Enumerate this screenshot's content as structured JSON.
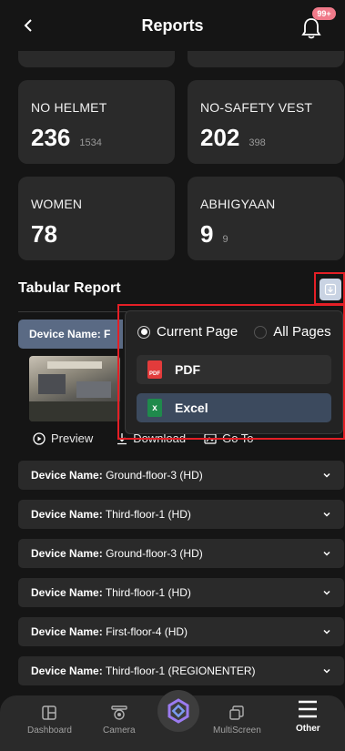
{
  "header": {
    "title": "Reports",
    "notification_badge": "99+"
  },
  "stats": [
    {
      "label": "NO HELMET",
      "value": "236",
      "sub": "1534"
    },
    {
      "label": "NO-SAFETY VEST",
      "value": "202",
      "sub": "398"
    },
    {
      "label": "WOMEN",
      "value": "78",
      "sub": ""
    },
    {
      "label": "ABHIGYAAN",
      "value": "9",
      "sub": "9"
    }
  ],
  "tabular": {
    "title": "Tabular Report",
    "expanded_row_prefix": "Device Name: F",
    "actions": {
      "preview": "Preview",
      "download": "Download",
      "goto": "Go To"
    }
  },
  "export_menu": {
    "scope_options": [
      "Current Page",
      "All Pages"
    ],
    "selected_scope": "Current Page",
    "formats": [
      "PDF",
      "Excel"
    ]
  },
  "device_rows": [
    {
      "prefix": "Device Name:",
      "name": "Ground-floor-3 (HD)"
    },
    {
      "prefix": "Device Name:",
      "name": "Third-floor-1 (HD)"
    },
    {
      "prefix": "Device Name:",
      "name": "Ground-floor-3 (HD)"
    },
    {
      "prefix": "Device Name:",
      "name": "Third-floor-1 (HD)"
    },
    {
      "prefix": "Device Name:",
      "name": "First-floor-4 (HD)"
    },
    {
      "prefix": "Device Name:",
      "name": "Third-floor-1 (REGIONENTER)"
    }
  ],
  "nav": {
    "dashboard": "Dashboard",
    "camera": "Camera",
    "multiscreen": "MultiScreen",
    "other": "Other"
  },
  "colors": {
    "background": "#151515",
    "card": "#2a2a2a",
    "highlight": "#e41f26",
    "badge": "#f07a8a"
  }
}
